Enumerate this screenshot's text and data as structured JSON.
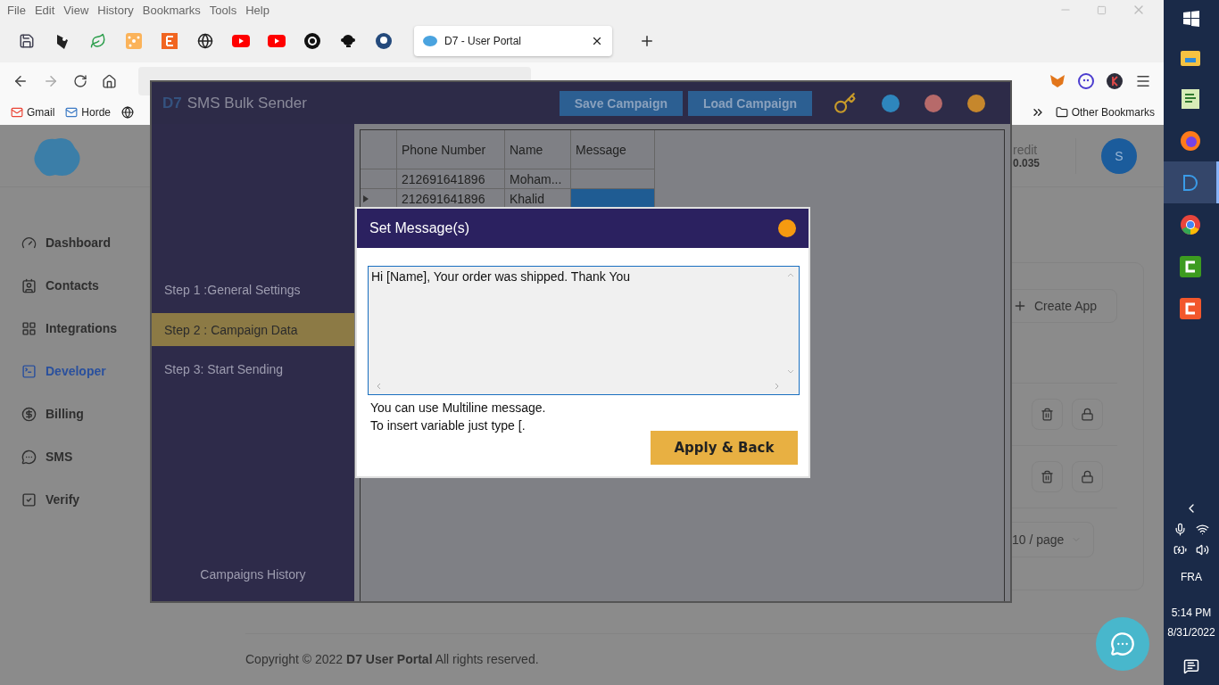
{
  "browser": {
    "menu": [
      "File",
      "Edit",
      "View",
      "History",
      "Bookmarks",
      "Tools",
      "Help"
    ],
    "tabs": [
      {
        "title": "D7 - User Portal",
        "selected": true
      }
    ],
    "bookmarks": [
      "Gmail",
      "Horde"
    ],
    "other_bookmarks": "Other Bookmarks"
  },
  "portal": {
    "credit_label": "redit",
    "credit_value": "0.035",
    "avatar": "S",
    "nav": [
      {
        "label": "Dashboard",
        "selected": false
      },
      {
        "label": "Contacts",
        "selected": false
      },
      {
        "label": "Integrations",
        "selected": false
      },
      {
        "label": "Developer",
        "selected": true
      },
      {
        "label": "Billing",
        "selected": false
      },
      {
        "label": "SMS",
        "selected": false
      },
      {
        "label": "Verify",
        "selected": false
      }
    ],
    "create_button": "Create App",
    "page_size": "10 / page",
    "footer": "Copyright © 2022 **D7 User Portal** All rights reserved."
  },
  "app": {
    "logo": "D7",
    "title": "SMS Bulk Sender",
    "buttons": [
      "Save Campaign",
      "Load Campaign"
    ],
    "dots": [
      {
        "color": "#2e86bd"
      },
      {
        "color": "#b76a6a"
      },
      {
        "color": "#c6872c"
      }
    ],
    "steps": [
      {
        "label": "Step 1 :General Settings",
        "selected": false
      },
      {
        "label": "Step 2 : Campaign Data",
        "selected": true
      },
      {
        "label": "Step 3: Start Sending",
        "selected": false
      }
    ],
    "history": "Campaigns History",
    "columns": [
      "Phone Number",
      "Name",
      "Message"
    ],
    "rows": [
      {
        "phone": "212691641896",
        "name": "Moham...",
        "selected": false
      },
      {
        "phone": "212691641896",
        "name": "Khalid",
        "selected": true
      }
    ]
  },
  "dialog": {
    "title": "Set Message(s)",
    "message": "Hi [Name], Your order was shipped. Thank You",
    "help": [
      "You can use Multiline message.",
      "To insert variable just type [."
    ],
    "button": "Apply & Back"
  },
  "taskbar": {
    "apps": [
      {
        "kind": "explorer",
        "selected": false
      },
      {
        "kind": "notepad",
        "selected": false
      },
      {
        "kind": "firefox",
        "selected": false
      },
      {
        "kind": "d7",
        "selected": true
      },
      {
        "kind": "chrome",
        "selected": false
      },
      {
        "kind": "camtasia",
        "selected": false
      },
      {
        "kind": "recorder",
        "selected": false
      }
    ],
    "language": "FRA",
    "time": "5:14 PM",
    "date": "8/31/2022"
  }
}
